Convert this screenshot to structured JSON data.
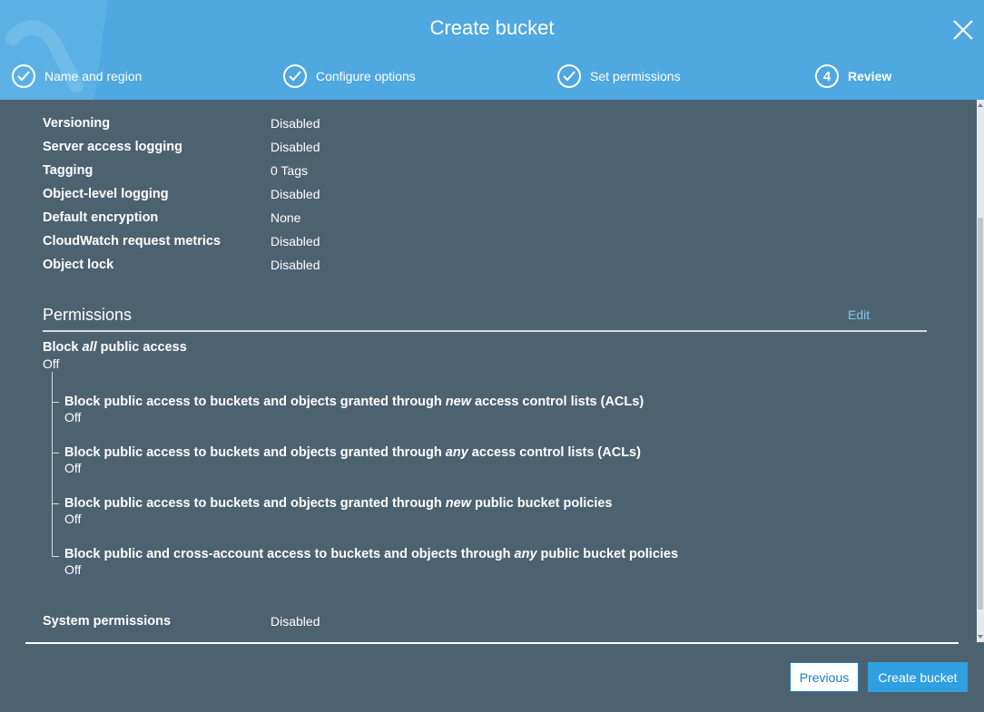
{
  "header": {
    "title": "Create bucket",
    "steps": [
      {
        "label": "Name and region",
        "state": "complete",
        "icon": "check-icon"
      },
      {
        "label": "Configure options",
        "state": "complete",
        "icon": "check-icon"
      },
      {
        "label": "Set permissions",
        "state": "complete",
        "icon": "check-icon"
      },
      {
        "label": "Review",
        "state": "active",
        "number": "4"
      }
    ]
  },
  "options": [
    {
      "key": "Versioning",
      "value": "Disabled"
    },
    {
      "key": "Server access logging",
      "value": "Disabled"
    },
    {
      "key": "Tagging",
      "value": "0 Tags"
    },
    {
      "key": "Object-level logging",
      "value": "Disabled"
    },
    {
      "key": "Default encryption",
      "value": "None"
    },
    {
      "key": "CloudWatch request metrics",
      "value": "Disabled"
    },
    {
      "key": "Object lock",
      "value": "Disabled"
    }
  ],
  "permissions": {
    "title": "Permissions",
    "edit_label": "Edit",
    "block_all": {
      "prefix": "Block ",
      "emphasis": "all",
      "suffix": " public access",
      "value": "Off"
    },
    "items": [
      {
        "prefix": "Block public access to buckets and objects granted through ",
        "emphasis": "new",
        "suffix": " access control lists (ACLs)",
        "value": "Off"
      },
      {
        "prefix": "Block public access to buckets and objects granted through ",
        "emphasis": "any",
        "suffix": " access control lists (ACLs)",
        "value": "Off"
      },
      {
        "prefix": "Block public access to buckets and objects granted through ",
        "emphasis": "new",
        "suffix": " public bucket policies",
        "value": "Off"
      },
      {
        "prefix": "Block public and cross-account access to buckets and objects through ",
        "emphasis": "any",
        "suffix": " public bucket policies",
        "value": "Off"
      }
    ]
  },
  "system_permissions": {
    "key": "System permissions",
    "value": "Disabled"
  },
  "footer": {
    "previous_label": "Previous",
    "create_label": "Create bucket"
  },
  "colors": {
    "header_bg": "#4fa8df",
    "body_bg": "#4d6271",
    "link": "#7fcaf0",
    "primary_button": "#2f9fe0",
    "secondary_button_border": "#1a7ec2"
  }
}
